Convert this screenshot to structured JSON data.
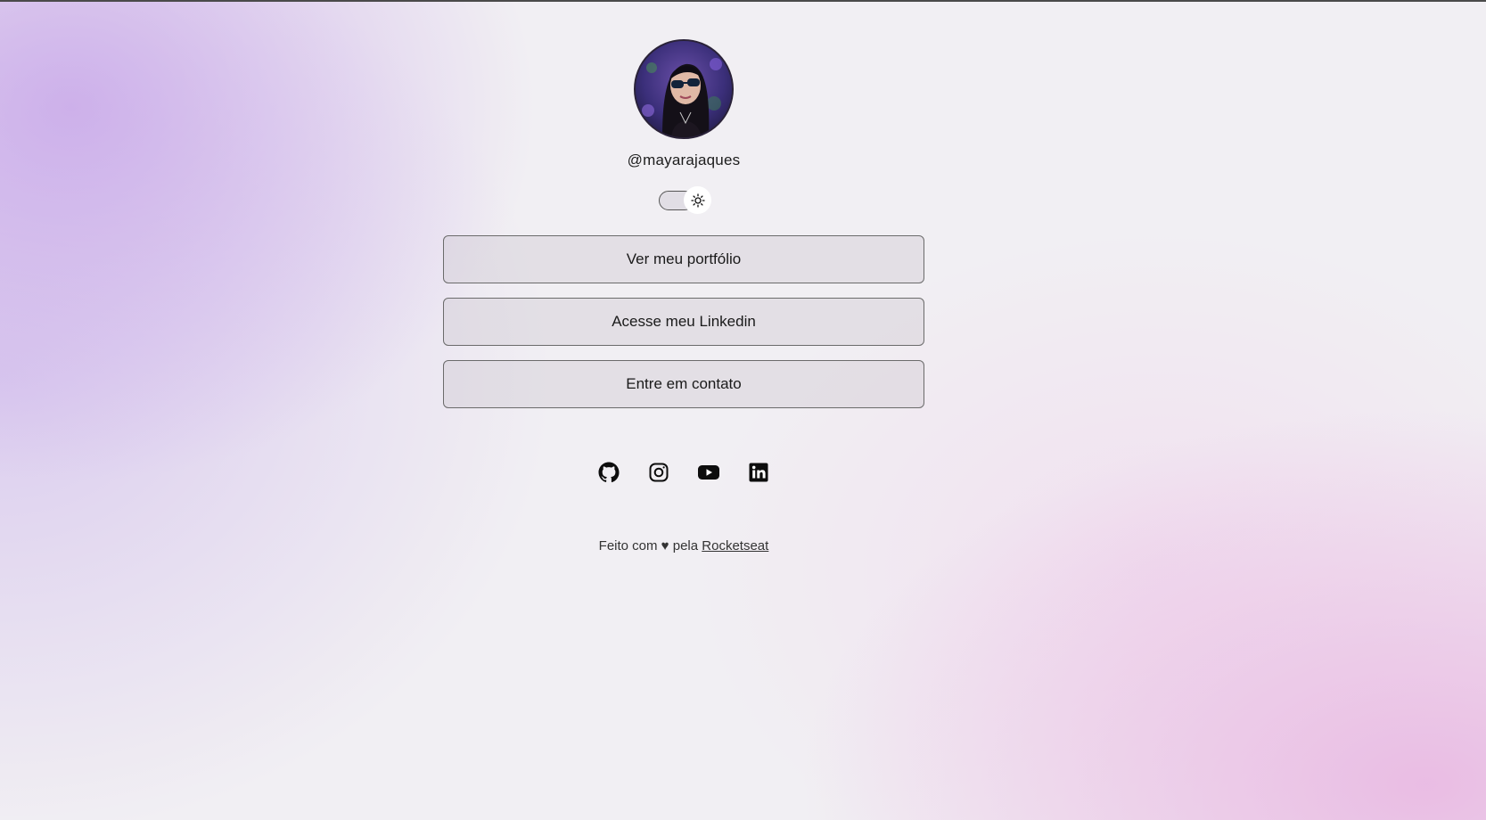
{
  "profile": {
    "username": "@mayarajaques"
  },
  "theme_toggle": {
    "icon": "sun-icon",
    "state": "light"
  },
  "links": [
    {
      "label": "Ver meu portfólio"
    },
    {
      "label": "Acesse meu Linkedin"
    },
    {
      "label": "Entre em contato"
    }
  ],
  "socials": [
    {
      "icon": "github-icon"
    },
    {
      "icon": "instagram-icon"
    },
    {
      "icon": "youtube-icon"
    },
    {
      "icon": "linkedin-icon"
    }
  ],
  "footer": {
    "text": "Feito com ♥ pela",
    "link_text": "Rocketseat"
  },
  "colors": {
    "background": "#f1eff3",
    "accent_purple": "#c4a0e8",
    "accent_pink": "#e8b4e1",
    "button_border": "#6b6b6b"
  }
}
